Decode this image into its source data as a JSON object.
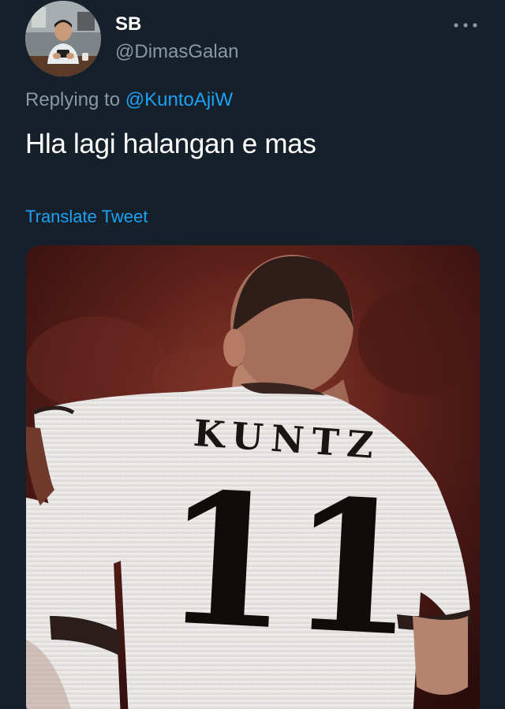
{
  "author": {
    "display_name": "SB",
    "handle": "@DimasGalan",
    "avatar_icon": "profile-photo"
  },
  "more_icon": "more-horizontal-icon",
  "reply": {
    "prefix": "Replying to ",
    "mention": "@KuntoAjiW"
  },
  "tweet": {
    "text": "Hla lagi halangan e mas",
    "translate_label": "Translate Tweet"
  },
  "media": {
    "jersey_name": "KUNTZ",
    "jersey_number": "11"
  },
  "colors": {
    "background": "#15202b",
    "secondary_text": "#8899a6",
    "link": "#1da1f2",
    "primary_text": "#ffffff"
  }
}
